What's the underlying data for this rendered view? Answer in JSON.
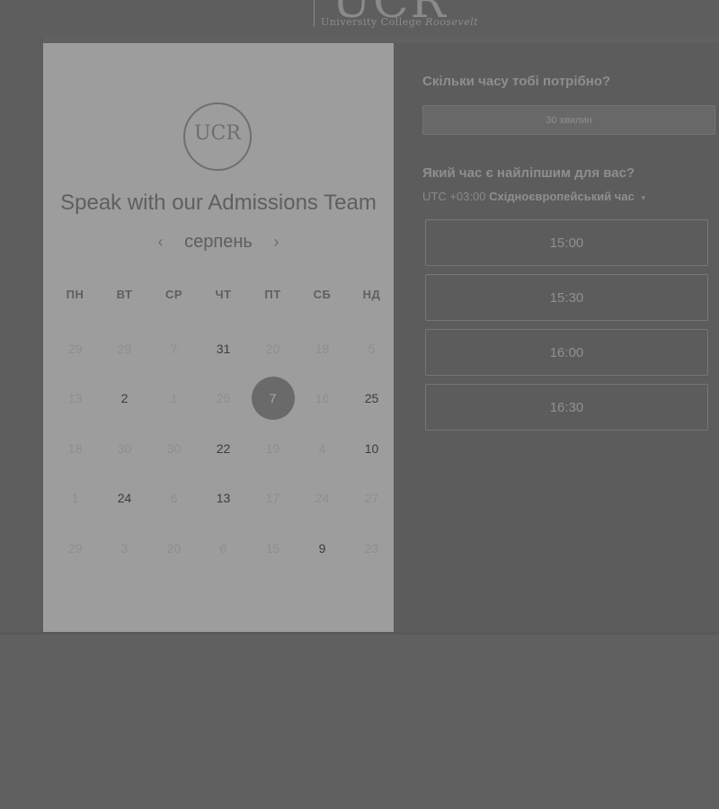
{
  "header": {
    "logo_text": "UCR",
    "logo_subtitle_1": "University College",
    "logo_subtitle_2": "Roosevelt"
  },
  "left": {
    "logo_text": "UCR",
    "title": "Speak with our Admissions Team",
    "prev_icon": "‹",
    "next_icon": "›",
    "month": "серпень",
    "weekdays": [
      "ПН",
      "ВТ",
      "СР",
      "ЧТ",
      "ПТ",
      "СБ",
      "НД"
    ],
    "weeks": [
      [
        {
          "d": "29",
          "available": false
        },
        {
          "d": "29",
          "available": false
        },
        {
          "d": "7",
          "available": false
        },
        {
          "d": "31",
          "available": true
        },
        {
          "d": "20",
          "available": false
        },
        {
          "d": "19",
          "available": false
        },
        {
          "d": "5",
          "available": false
        }
      ],
      [
        {
          "d": "13",
          "available": false
        },
        {
          "d": "2",
          "available": true
        },
        {
          "d": "1",
          "available": false
        },
        {
          "d": "25",
          "available": false
        },
        {
          "d": "7",
          "available": true,
          "selected": true
        },
        {
          "d": "16",
          "available": false
        },
        {
          "d": "25",
          "available": true
        }
      ],
      [
        {
          "d": "18",
          "available": false
        },
        {
          "d": "30",
          "available": false
        },
        {
          "d": "30",
          "available": false
        },
        {
          "d": "22",
          "available": true
        },
        {
          "d": "19",
          "available": false
        },
        {
          "d": "4",
          "available": false
        },
        {
          "d": "10",
          "available": true
        }
      ],
      [
        {
          "d": "1",
          "available": false
        },
        {
          "d": "24",
          "available": true
        },
        {
          "d": "6",
          "available": false
        },
        {
          "d": "13",
          "available": true
        },
        {
          "d": "17",
          "available": false
        },
        {
          "d": "24",
          "available": false
        },
        {
          "d": "27",
          "available": false
        }
      ],
      [
        {
          "d": "29",
          "available": false
        },
        {
          "d": "3",
          "available": false
        },
        {
          "d": "20",
          "available": false
        },
        {
          "d": "6",
          "available": false
        },
        {
          "d": "15",
          "available": false
        },
        {
          "d": "9",
          "available": true
        },
        {
          "d": "23",
          "available": false
        }
      ]
    ]
  },
  "right": {
    "question_duration": "Скільки часу тобі потрібно?",
    "duration_value": "30 хвилин",
    "question_time": "Який час є найліпшим для вас?",
    "timezone_offset": "UTC +03:00",
    "timezone_name": "Східноєвропейський час",
    "timezone_caret": "▾",
    "slots": [
      "15:00",
      "15:30",
      "16:00",
      "16:30"
    ]
  }
}
